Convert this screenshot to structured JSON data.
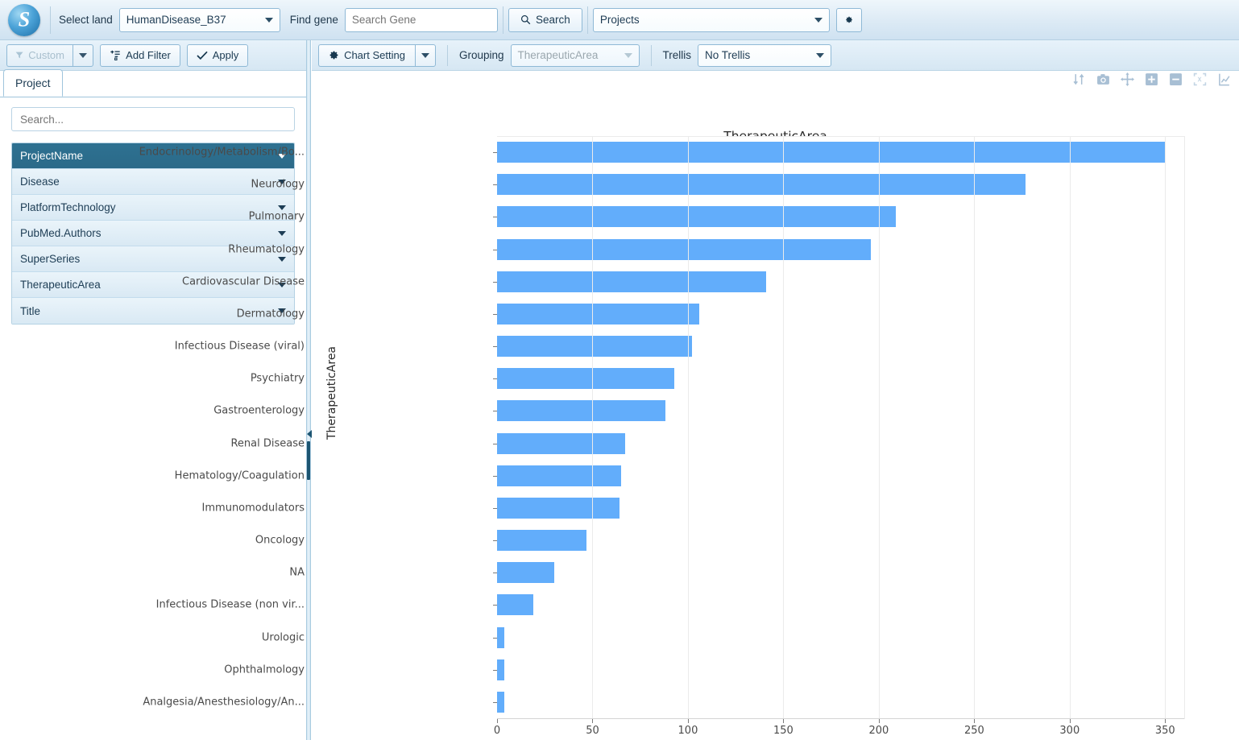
{
  "topbar": {
    "logo_alt": "omicsoft-logo",
    "select_land_label": "Select land",
    "land_value": "HumanDisease_B37",
    "find_gene_label": "Find gene",
    "gene_placeholder": "Search Gene",
    "search_button": "Search",
    "projects_value": "Projects",
    "settings_icon": "gear-icon"
  },
  "filterbar": {
    "custom_label": "Custom",
    "add_filter_label": "Add Filter",
    "apply_label": "Apply"
  },
  "left_panel": {
    "tab_label": "Project",
    "search_placeholder": "Search...",
    "fields": [
      {
        "label": "ProjectName",
        "active": true
      },
      {
        "label": "Disease",
        "active": false
      },
      {
        "label": "PlatformTechnology",
        "active": false
      },
      {
        "label": "PubMed.Authors",
        "active": false
      },
      {
        "label": "SuperSeries",
        "active": false
      },
      {
        "label": "TherapeuticArea",
        "active": false
      },
      {
        "label": "Title",
        "active": false
      }
    ]
  },
  "chart_toolbar": {
    "chart_setting_label": "Chart Setting",
    "grouping_label": "Grouping",
    "grouping_value": "TherapeuticArea",
    "trellis_label": "Trellis",
    "trellis_value": "No Trellis",
    "modebar_icons": [
      "sort-icon",
      "camera-icon",
      "pan-icon",
      "zoom-in-icon",
      "zoom-out-icon",
      "autoscale-icon",
      "reset-axes-icon"
    ]
  },
  "chart_data": {
    "type": "bar",
    "orientation": "horizontal",
    "title": "TherapeuticArea",
    "xlabel": "",
    "ylabel": "TherapeuticArea",
    "xlim": [
      0,
      360
    ],
    "xticks": [
      0,
      50,
      100,
      150,
      200,
      250,
      300,
      350
    ],
    "grid": true,
    "bar_color": "#62adfb",
    "categories": [
      "Endocrinology/Metabolism/Bo...",
      "Neurology",
      "Pulmonary",
      "Rheumatology",
      "Cardiovascular Disease",
      "Dermatology",
      "Infectious Disease (viral)",
      "Psychiatry",
      "Gastroenterology",
      "Renal Disease",
      "Hematology/Coagulation",
      "Immunomodulators",
      "Oncology",
      "NA",
      "Infectious Disease (non vir...",
      "Urologic",
      "Ophthalmology",
      "Analgesia/Anesthesiology/An..."
    ],
    "values": [
      350,
      277,
      209,
      196,
      141,
      106,
      102,
      93,
      88,
      67,
      65,
      64,
      47,
      30,
      19,
      4,
      4,
      4
    ]
  }
}
